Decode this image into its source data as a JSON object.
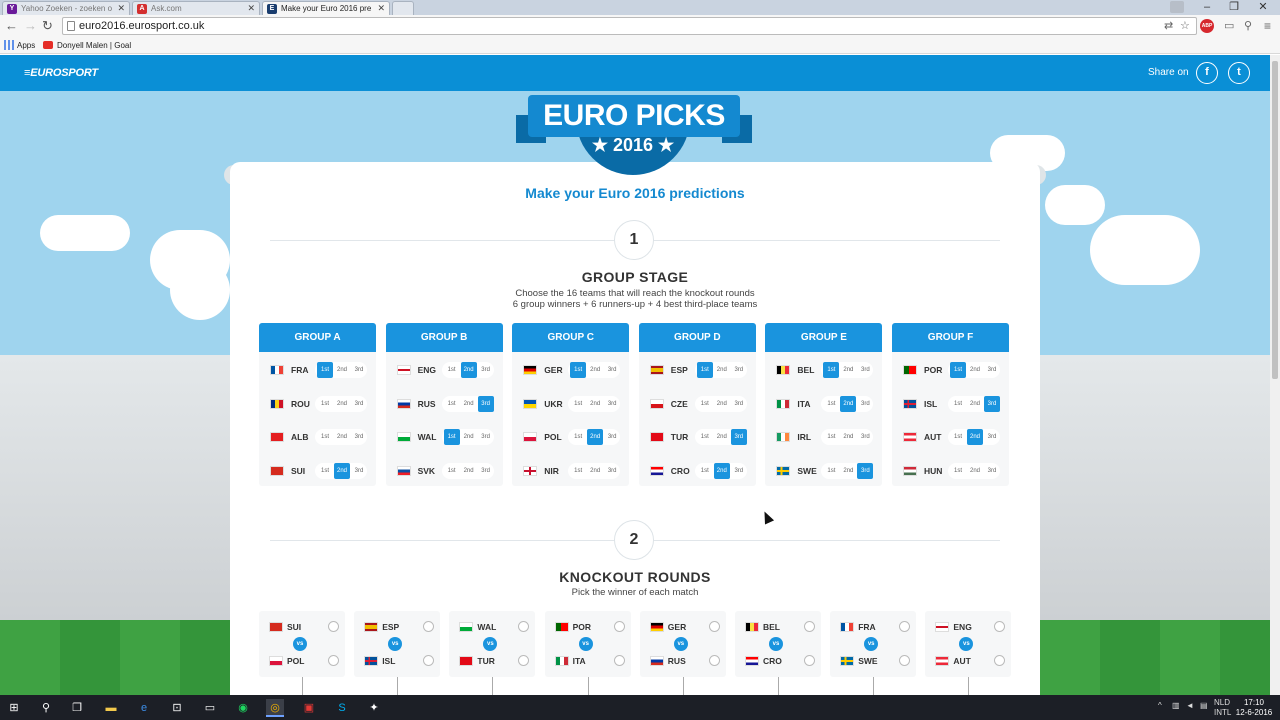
{
  "browser": {
    "tabs": [
      {
        "title": "Yahoo Zoeken - zoeken o",
        "fav": "Y",
        "fav_color": "#6a1b9a"
      },
      {
        "title": "Ask.com",
        "fav": "A",
        "fav_color": "#d32f2f"
      },
      {
        "title": "Make your Euro 2016 pre",
        "fav": "E",
        "fav_color": "#1a3d6e"
      }
    ],
    "url": "euro2016.eurosport.co.uk",
    "bookmarks": {
      "apps": "Apps",
      "item1": "Donyell Malen | Goal"
    },
    "window": {
      "minimize": "–",
      "maximize": "❐",
      "close": "✕"
    },
    "abp": "ABP"
  },
  "header": {
    "logo": "≡EUROSPORT",
    "share_label": "Share on",
    "facebook": "f",
    "twitter": "t",
    "accent": "#0a8fd6"
  },
  "logo": {
    "title": "EURO PICKS",
    "year": "★ 2016 ★"
  },
  "subtitle": "Make your Euro 2016 predictions",
  "group_stage": {
    "step": "1",
    "title": "GROUP STAGE",
    "desc1": "Choose the 16 teams that will reach the knockout rounds",
    "desc2": "6 group winners + 6 runners-up + 4 best third-place teams",
    "pick_labels": [
      "1st",
      "2nd",
      "3rd"
    ],
    "groups": [
      {
        "name": "GROUP A",
        "teams": [
          {
            "code": "FRA",
            "flag": "fr",
            "pick": 0
          },
          {
            "code": "ROU",
            "flag": "ro",
            "pick": -1
          },
          {
            "code": "ALB",
            "flag": "al",
            "pick": -1
          },
          {
            "code": "SUI",
            "flag": "ch",
            "pick": 1
          }
        ]
      },
      {
        "name": "GROUP B",
        "teams": [
          {
            "code": "ENG",
            "flag": "en",
            "pick": 1
          },
          {
            "code": "RUS",
            "flag": "ru",
            "pick": 2
          },
          {
            "code": "WAL",
            "flag": "wa",
            "pick": 0
          },
          {
            "code": "SVK",
            "flag": "sk",
            "pick": -1
          }
        ]
      },
      {
        "name": "GROUP C",
        "teams": [
          {
            "code": "GER",
            "flag": "de",
            "pick": 0
          },
          {
            "code": "UKR",
            "flag": "ua",
            "pick": -1
          },
          {
            "code": "POL",
            "flag": "pl",
            "pick": 1
          },
          {
            "code": "NIR",
            "flag": "ni",
            "pick": -1
          }
        ]
      },
      {
        "name": "GROUP D",
        "teams": [
          {
            "code": "ESP",
            "flag": "es",
            "pick": 0
          },
          {
            "code": "CZE",
            "flag": "cz",
            "pick": -1
          },
          {
            "code": "TUR",
            "flag": "tr",
            "pick": 2
          },
          {
            "code": "CRO",
            "flag": "hr",
            "pick": 1
          }
        ]
      },
      {
        "name": "GROUP E",
        "teams": [
          {
            "code": "BEL",
            "flag": "be",
            "pick": 0
          },
          {
            "code": "ITA",
            "flag": "it",
            "pick": 1
          },
          {
            "code": "IRL",
            "flag": "ie",
            "pick": -1
          },
          {
            "code": "SWE",
            "flag": "se",
            "pick": 2
          }
        ]
      },
      {
        "name": "GROUP F",
        "teams": [
          {
            "code": "POR",
            "flag": "pt",
            "pick": 0
          },
          {
            "code": "ISL",
            "flag": "is",
            "pick": 2
          },
          {
            "code": "AUT",
            "flag": "at",
            "pick": 1
          },
          {
            "code": "HUN",
            "flag": "hu",
            "pick": -1
          }
        ]
      }
    ]
  },
  "knockout": {
    "step": "2",
    "title": "KNOCKOUT ROUNDS",
    "desc": "Pick the winner of each match",
    "vs": "vs",
    "matches": [
      {
        "home": {
          "code": "SUI",
          "flag": "ch"
        },
        "away": {
          "code": "POL",
          "flag": "pl"
        }
      },
      {
        "home": {
          "code": "ESP",
          "flag": "es"
        },
        "away": {
          "code": "ISL",
          "flag": "is"
        }
      },
      {
        "home": {
          "code": "WAL",
          "flag": "wa"
        },
        "away": {
          "code": "TUR",
          "flag": "tr"
        }
      },
      {
        "home": {
          "code": "POR",
          "flag": "pt"
        },
        "away": {
          "code": "ITA",
          "flag": "it"
        }
      },
      {
        "home": {
          "code": "GER",
          "flag": "de"
        },
        "away": {
          "code": "RUS",
          "flag": "ru"
        }
      },
      {
        "home": {
          "code": "BEL",
          "flag": "be"
        },
        "away": {
          "code": "CRO",
          "flag": "hr"
        }
      },
      {
        "home": {
          "code": "FRA",
          "flag": "fr"
        },
        "away": {
          "code": "SWE",
          "flag": "se"
        }
      },
      {
        "home": {
          "code": "ENG",
          "flag": "en"
        },
        "away": {
          "code": "AUT",
          "flag": "at"
        }
      }
    ]
  },
  "taskbar": {
    "lang1": "NLD",
    "lang2": "INTL",
    "time": "17:10",
    "date": "12-6-2016"
  }
}
